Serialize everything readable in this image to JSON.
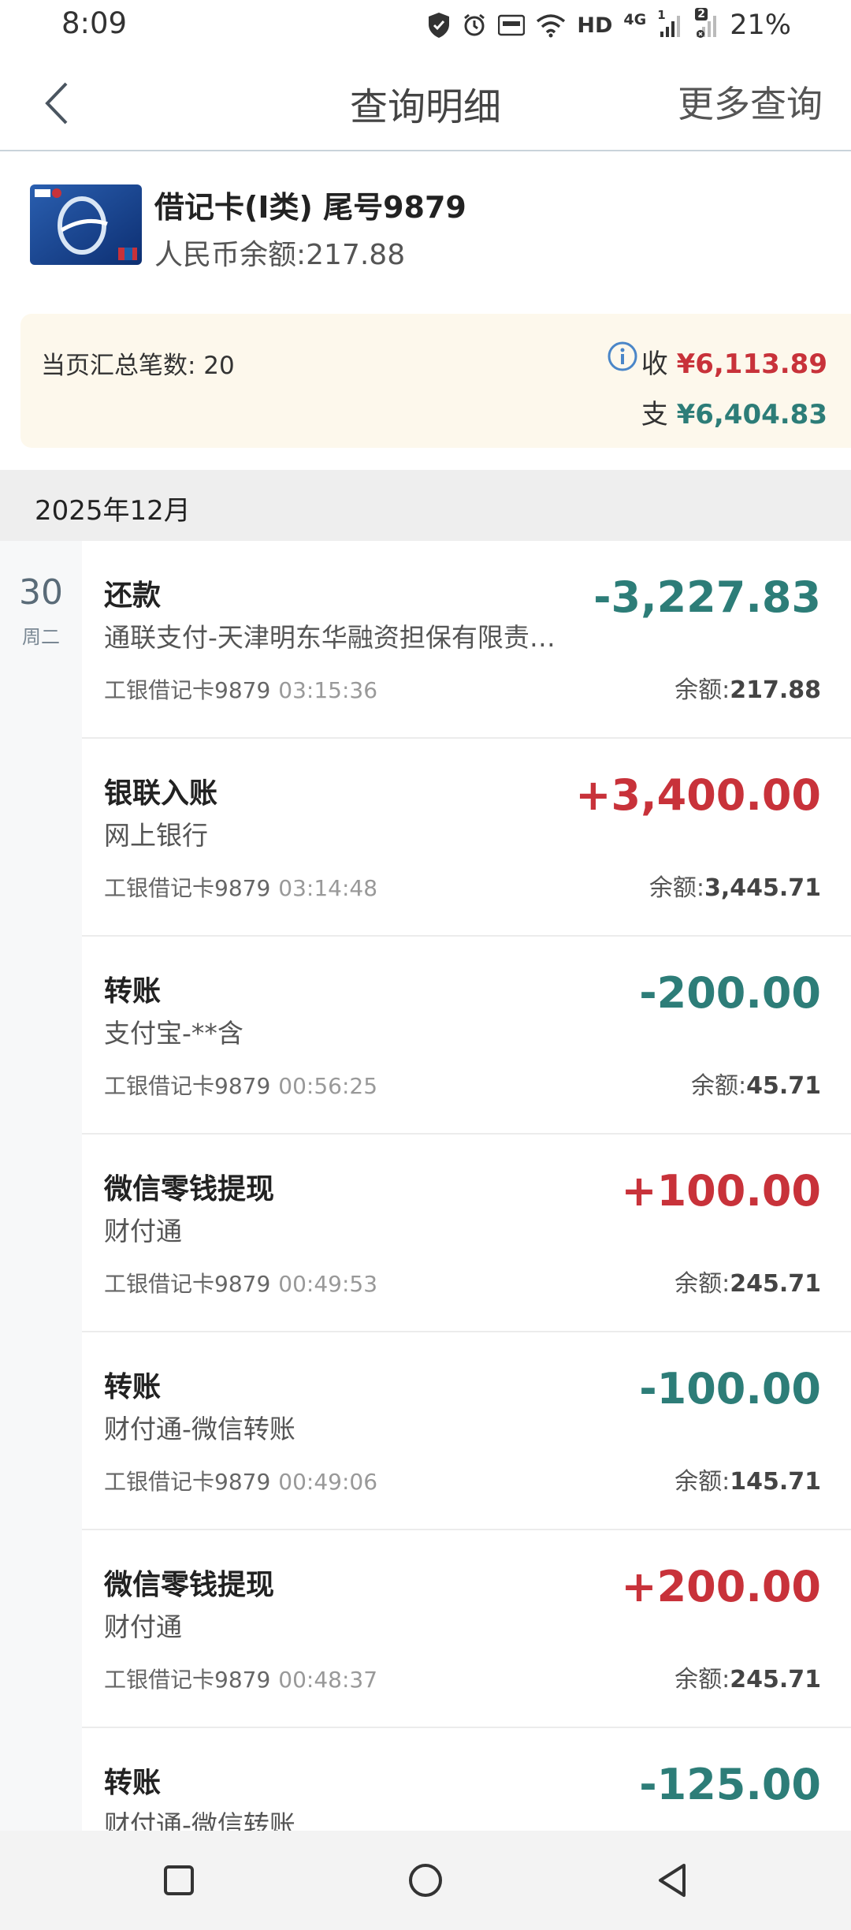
{
  "status_bar": {
    "time": "8:09",
    "hd": "HD",
    "net": "4G",
    "sim1": "1",
    "sim2": "2",
    "battery": "21%"
  },
  "header": {
    "title": "查询明细",
    "more": "更多查询"
  },
  "card": {
    "name": "借记卡(Ⅰ类) 尾号9879",
    "balance": "人民币余额:217.88"
  },
  "summary": {
    "count": "当页汇总笔数: 20",
    "income_label": "收",
    "income": "¥6,113.89",
    "expense_label": "支",
    "expense": "¥6,404.83"
  },
  "month": "2025年12月",
  "date": {
    "day": "30",
    "weekday": "周二"
  },
  "transactions": [
    {
      "title": "还款",
      "desc": "通联支付-天津明东华融资担保有限责任公司",
      "account": "工银借记卡9879",
      "time": "03:15:36",
      "amount": "-3,227.83",
      "balance_label": "余额:",
      "balance": "217.88",
      "type": "out"
    },
    {
      "title": "银联入账",
      "desc": "网上银行",
      "account": "工银借记卡9879",
      "time": "03:14:48",
      "amount": "+3,400.00",
      "balance_label": "余额:",
      "balance": "3,445.71",
      "type": "in"
    },
    {
      "title": "转账",
      "desc": "支付宝-**含",
      "account": "工银借记卡9879",
      "time": "00:56:25",
      "amount": "-200.00",
      "balance_label": "余额:",
      "balance": "45.71",
      "type": "out"
    },
    {
      "title": "微信零钱提现",
      "desc": "财付通",
      "account": "工银借记卡9879",
      "time": "00:49:53",
      "amount": "+100.00",
      "balance_label": "余额:",
      "balance": "245.71",
      "type": "in"
    },
    {
      "title": "转账",
      "desc": "财付通-微信转账",
      "account": "工银借记卡9879",
      "time": "00:49:06",
      "amount": "-100.00",
      "balance_label": "余额:",
      "balance": "145.71",
      "type": "out"
    },
    {
      "title": "微信零钱提现",
      "desc": "财付通",
      "account": "工银借记卡9879",
      "time": "00:48:37",
      "amount": "+200.00",
      "balance_label": "余额:",
      "balance": "245.71",
      "type": "in"
    },
    {
      "title": "转账",
      "desc": "财付通-微信转账",
      "account": "",
      "time": "",
      "amount": "-125.00",
      "balance_label": "",
      "balance": "",
      "type": "out"
    }
  ],
  "colors": {
    "income": "#c8323a",
    "expense": "#2d7d78",
    "summary_bg": "#fdf8ec"
  }
}
